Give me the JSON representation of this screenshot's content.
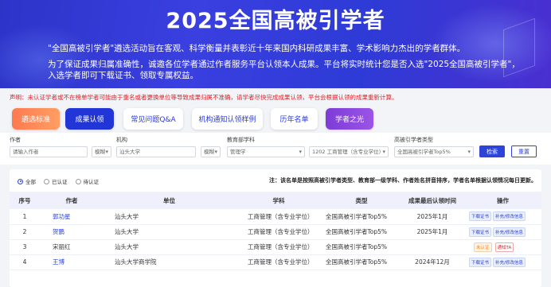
{
  "banner": {
    "title": "2025全国高被引学者",
    "paragraph1": "\"全国高被引学者\"遴选活动旨在客观、科学衡量并表彰近十年来国内科研成果丰富、学术影响力杰出的学者群体。",
    "paragraph2": "为了保证成果归属准确性，诚邀各位学者通过作者服务平台认领本人成果。平台将实时统计您是否入选\"2025全国高被引学者\"，入选学者即可下载证书、领取专属权益。"
  },
  "notice": "声明：未认证学者或不在榜单学者可能由于重名或者更换单位等导致成果归属不准确，请学者尽快完成成果认领，平台会根据认领的成果重新计算。",
  "tabs": [
    "遴选标准",
    "成果认领",
    "常见问题Q&A",
    "机构通知认领样例",
    "历年名单",
    "学者之光"
  ],
  "filters": {
    "author_label": "作者",
    "author_placeholder": "请输入作者",
    "author_mode": "模糊",
    "org_label": "机构",
    "org_value": "汕头大学",
    "org_mode": "模糊",
    "edu_label": "教育部学科",
    "edu_value": "管理学",
    "sub_value": "1202 工商管理（含专业学位）",
    "type_label": "高被引学者类型",
    "type_value": "全国高被引学者Top5%",
    "search_label": "检索",
    "reset_label": "重置"
  },
  "radios": [
    "全部",
    "已认证",
    "待认证"
  ],
  "table_note": "注：该名单是按照高被引学者类型、教育部一级学科、作者姓名拼音排序，学者名单根据认领情况每日更新。",
  "columns": [
    "序号",
    "作者",
    "单位",
    "学科",
    "类型",
    "成果最后认领时间",
    "操作"
  ],
  "rows": [
    {
      "idx": "1",
      "author": "郭功星",
      "unit": "汕头大学",
      "subject": "工商管理（含专业学位）",
      "type": "全国高被引学者Top5%",
      "date": "2025年1月",
      "op1": "下载证书",
      "op2": "补充/修改信息"
    },
    {
      "idx": "2",
      "author": "贺鹏",
      "unit": "汕头大学",
      "subject": "工商管理（含专业学位）",
      "type": "全国高被引学者Top5%",
      "date": "2025年1月",
      "op1": "下载证书",
      "op2": "补充/修改信息"
    },
    {
      "idx": "3",
      "author": "宋丽红",
      "unit": "汕头大学",
      "subject": "工商管理（含专业学位）",
      "type": "全国高被引学者Top5%",
      "date": "",
      "op1": "未认证",
      "op2": "通知TA"
    },
    {
      "idx": "4",
      "author": "王博",
      "unit": "汕头大学商学院",
      "subject": "工商管理（含专业学位）",
      "type": "全国高被引学者Top5%",
      "date": "2024年12月",
      "op1": "下载证书",
      "op2": "补充/修改信息"
    }
  ]
}
